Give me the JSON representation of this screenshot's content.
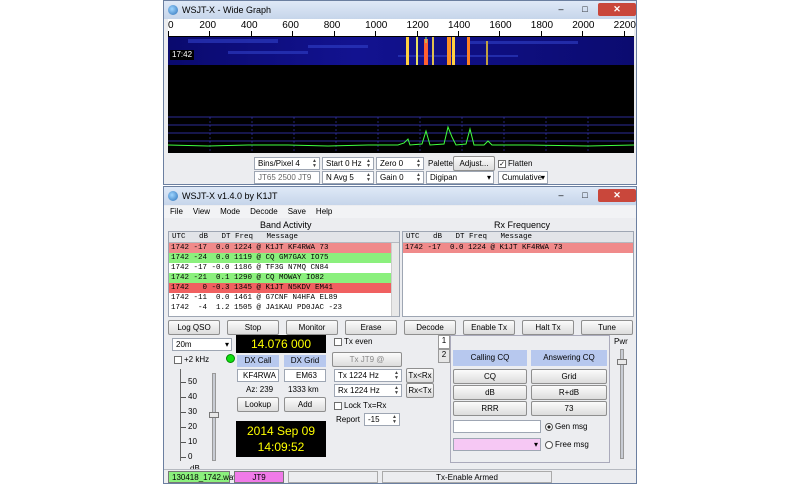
{
  "wide": {
    "title": "WSJT-X - Wide Graph",
    "freq_ticks": [
      "0",
      "200",
      "400",
      "600",
      "800",
      "1000",
      "1200",
      "1400",
      "1600",
      "1800",
      "2000",
      "2200"
    ],
    "time_stamp": "17:42",
    "controls": {
      "bins_pixel": "Bins/Pixel 4",
      "start": "Start 0 Hz",
      "zero": "Zero 0",
      "palette_label": "Palette",
      "adjust": "Adjust...",
      "flatten": "Flatten",
      "mode_info": "JT65 2500 JT9",
      "navg": "N Avg 5",
      "gain": "Gain 0",
      "palette_value": "Digipan",
      "cumulative": "Cumulative"
    }
  },
  "main": {
    "title": "WSJT-X   v1.4.0   by K1JT",
    "menu": [
      "File",
      "View",
      "Mode",
      "Decode",
      "Save",
      "Help"
    ],
    "band_activity_title": "Band Activity",
    "rx_frequency_title": "Rx Frequency",
    "columns": "UTC   dB   DT Freq   Message",
    "band_rows": [
      {
        "text": "1742 -17  0.0 1224 @ K1JT KF4RWA 73",
        "bg": "#f08a8a"
      },
      {
        "text": "1742 -24  0.0 1119 @ CQ GM7GAX IO75",
        "bg": "#8bf07d"
      },
      {
        "text": "1742 -17 -0.0 1186 @ TF3G N7MQ CN84",
        "bg": "#ffffff"
      },
      {
        "text": "1742 -21  0.1 1290 @ CQ MOWAY IO82",
        "bg": "#8bf07d"
      },
      {
        "text": "1742   0 -0.3 1345 @ K1JT N5KDV EM41",
        "bg": "#f06060"
      },
      {
        "text": "1742 -11  0.0 1461 @ G7CNF N4HFA EL89",
        "bg": "#ffffff"
      },
      {
        "text": "1742  -4  1.2 1505 @ JA1KAU PD0JAC -23",
        "bg": "#ffffff"
      }
    ],
    "rx_rows": [
      {
        "text": "1742 -17  0.0 1224 @ K1JT KF4RWA 73",
        "bg": "#f08a8a"
      }
    ],
    "buttons": {
      "log_qso": "Log QSO",
      "stop": "Stop",
      "monitor": "Monitor",
      "erase": "Erase",
      "decode": "Decode",
      "enable_tx": "Enable Tx",
      "halt_tx": "Halt Tx",
      "tune": "Tune"
    },
    "band": "20m",
    "khz_label": "+2 kHz",
    "frequency": "14.076 000",
    "dx_call_label": "DX Call",
    "dx_grid_label": "DX Grid",
    "dx_call": "KF4RWA",
    "dx_grid": "EM63",
    "az": "Az: 239",
    "dist": "1333 km",
    "lookup": "Lookup",
    "add": "Add",
    "date": "2014 Sep 09",
    "time": "14:09:52",
    "tx_even": "Tx even",
    "tx_jt9": "Tx JT9  @",
    "tx_freq": "Tx  1224 Hz",
    "rx_freq": "Rx  1224 Hz",
    "tx_from_rx": "Tx<Rx",
    "rx_from_tx": "Rx<Tx",
    "lock": "Lock Tx=Rx",
    "report_label": "Report",
    "report": "-15",
    "db_scale": [
      "50",
      "40",
      "30",
      "20",
      "10",
      "0"
    ],
    "db_unit": "dB",
    "tab_labels": [
      "1",
      "2"
    ],
    "calling_cq": "Calling CQ",
    "answering_cq": "Answering CQ",
    "cq_buttons": [
      "CQ",
      "Grid",
      "dB",
      "R+dB",
      "RRR",
      "73"
    ],
    "gen_msg": "Gen msg",
    "free_msg": "Free msg",
    "pwr": "Pwr",
    "status": {
      "file": "130418_1742.wav",
      "mode": "JT9",
      "tx": "Tx-Enable Armed"
    },
    "colors": {
      "green": "#8bf07d",
      "red": "#f08a8a",
      "mode_pink": "#f07ae8",
      "clock_bg": "#000000",
      "clock_fg": "#ffff00"
    }
  }
}
